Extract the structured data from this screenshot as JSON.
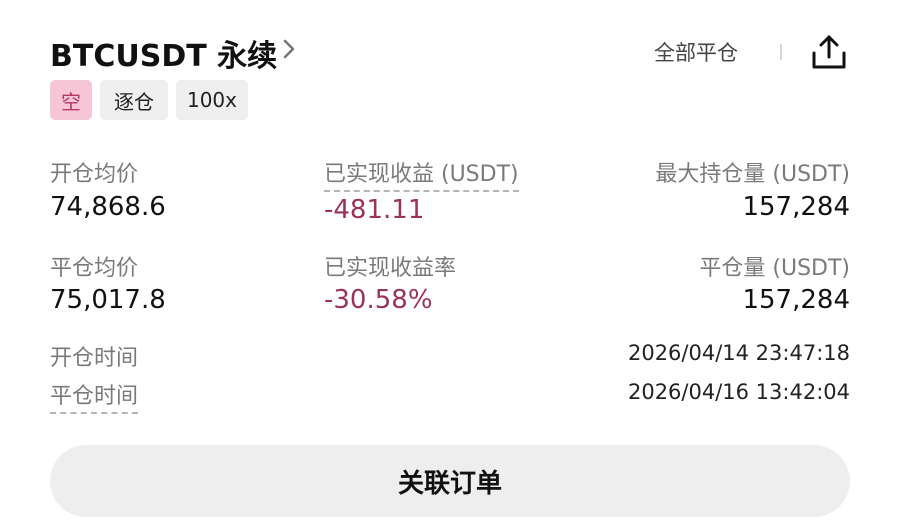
{
  "header": {
    "symbol": "BTCUSDT 永续",
    "close_all": "全部平仓"
  },
  "tags": {
    "side": "空",
    "margin_mode": "逐仓",
    "leverage": "100x"
  },
  "stats": {
    "open_avg_price": {
      "label": "开仓均价",
      "value": "74,868.6"
    },
    "realized_pnl": {
      "label": "已实现收益 (USDT)",
      "value": "-481.11"
    },
    "max_position": {
      "label": "最大持仓量 (USDT)",
      "value": "157,284"
    },
    "close_avg_price": {
      "label": "平仓均价",
      "value": "75,017.8"
    },
    "realized_pnl_rate": {
      "label": "已实现收益率",
      "value": "-30.58%"
    },
    "closed_amount": {
      "label": "平仓量 (USDT)",
      "value": "157,284"
    }
  },
  "times": {
    "open_time": {
      "label": "开仓时间",
      "value": "2026/04/14 23:47:18"
    },
    "close_time": {
      "label": "平仓时间",
      "value": "2026/04/16 13:42:04"
    }
  },
  "actions": {
    "related_orders": "关联订单"
  },
  "colors": {
    "negative": "#9a3355",
    "short_tag_bg": "#f7c6d6",
    "short_tag_text": "#b23a63",
    "neutral_tag_bg": "#efefef",
    "button_bg": "#eeeeee"
  },
  "icons": {
    "chevron": "chevron-right-icon",
    "share": "share-upload-icon"
  }
}
